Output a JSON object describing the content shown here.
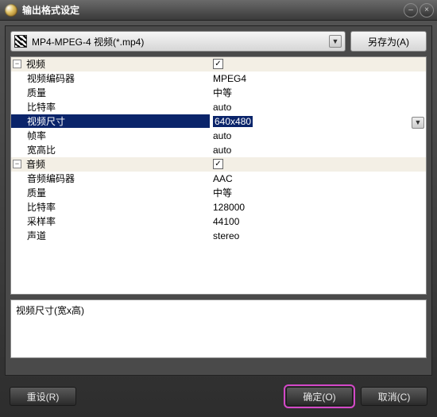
{
  "title": "输出格式设定",
  "window": {
    "min_glyph": "–",
    "close_glyph": "×"
  },
  "format_select": {
    "label": "MP4-MPEG-4 视频(*.mp4)"
  },
  "saveas_label": "另存为(A)",
  "groups": {
    "video_label": "视频",
    "audio_label": "音频"
  },
  "props": {
    "video_codec": {
      "label": "视频编码器",
      "value": "MPEG4"
    },
    "video_quality": {
      "label": "质量",
      "value": "中等"
    },
    "video_bitrate": {
      "label": "比特率",
      "value": "auto"
    },
    "video_size": {
      "label": "视频尺寸",
      "value": "640x480"
    },
    "video_fps": {
      "label": "帧率",
      "value": "auto"
    },
    "video_aspect": {
      "label": "宽高比",
      "value": "auto"
    },
    "audio_codec": {
      "label": "音频编码器",
      "value": "AAC"
    },
    "audio_quality": {
      "label": "质量",
      "value": "中等"
    },
    "audio_bitrate": {
      "label": "比特率",
      "value": "128000"
    },
    "audio_rate": {
      "label": "采样率",
      "value": "44100"
    },
    "audio_channel": {
      "label": "声道",
      "value": "stereo"
    }
  },
  "info_text": "视频尺寸(宽x高)",
  "footer": {
    "reset_label": "重设(R)",
    "ok_label": "确定(O)",
    "cancel_label": "取消(C)"
  }
}
